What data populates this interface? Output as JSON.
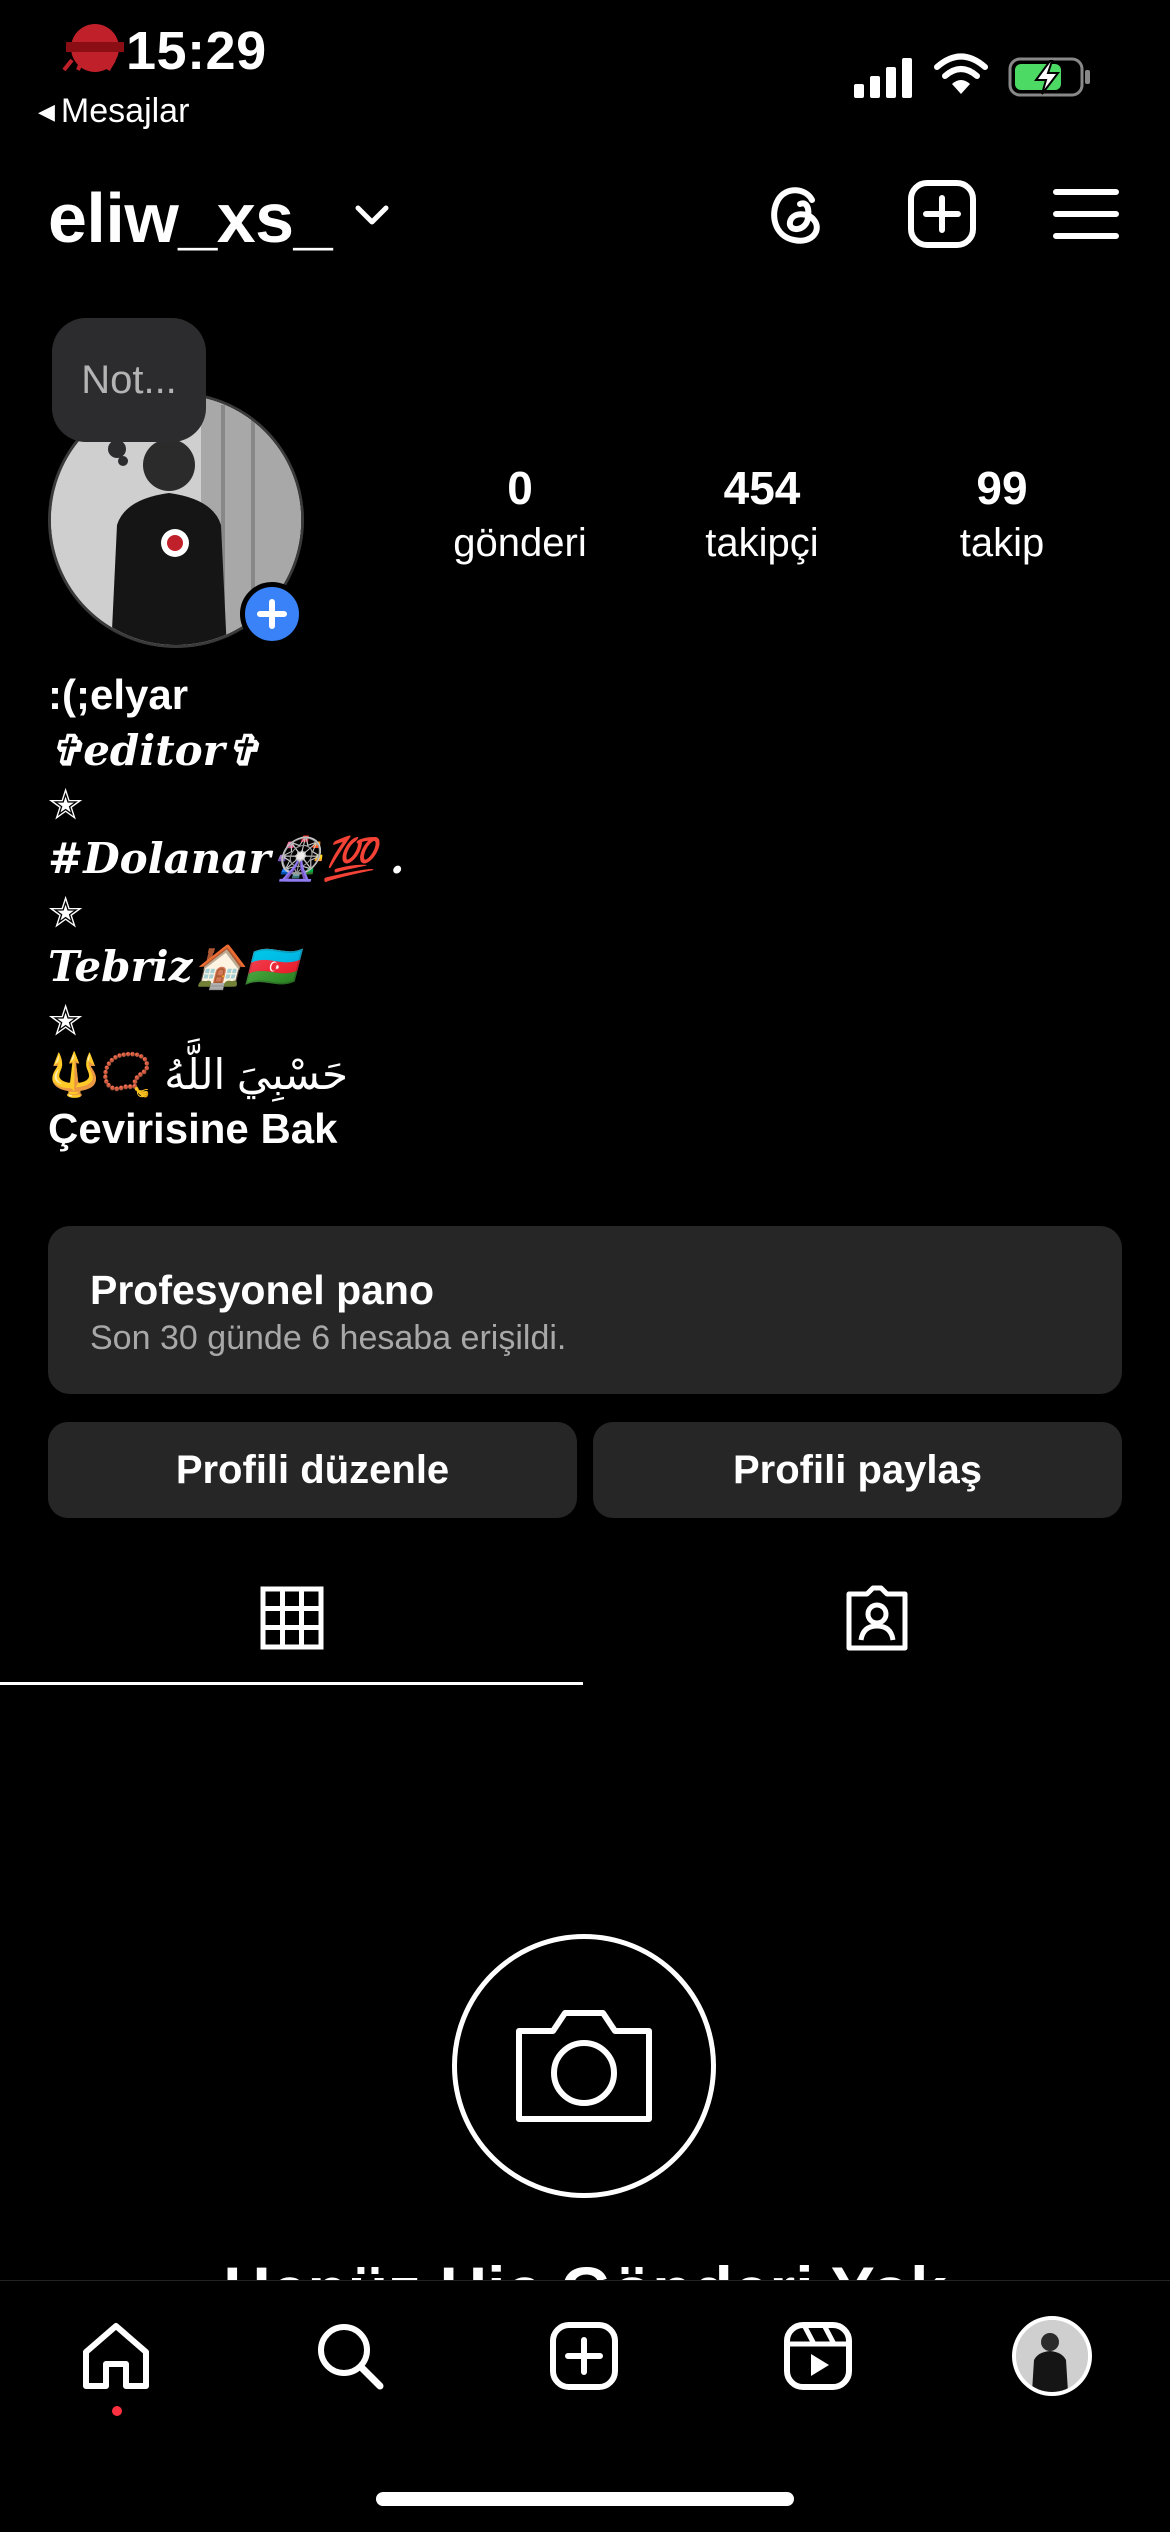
{
  "status_bar": {
    "time": "15:29",
    "back_label": "Mesajlar",
    "battery": "charging"
  },
  "header": {
    "username": "eliw_xs_",
    "icons": [
      "threads-icon",
      "create-plus-icon",
      "menu-icon"
    ]
  },
  "note": {
    "placeholder": "Not..."
  },
  "stats": [
    {
      "value": "0",
      "label": "gönderi"
    },
    {
      "value": "454",
      "label": "takipçi"
    },
    {
      "value": "99",
      "label": "takip"
    }
  ],
  "bio": {
    "name": ":(;elyar",
    "lines": [
      "✞editor✞",
      "✭",
      "#Dolanar🎡💯 .",
      "✭",
      "Tebriz🏠🇦🇿",
      "✭",
      "🔱📿 حَسْبِيَ اللَّهُ"
    ],
    "translate_link": "Çevirisine Bak"
  },
  "dashboard": {
    "title": "Profesyonel pano",
    "subtitle": "Son 30 günde 6 hesaba erişildi."
  },
  "buttons": {
    "edit_profile": "Profili düzenle",
    "share_profile": "Profili paylaş"
  },
  "tabs": {
    "active": "grid",
    "items": [
      "grid-icon",
      "tagged-icon"
    ]
  },
  "empty_state": {
    "text": "Henüz Hiç Gönderi Yok"
  },
  "bottom_nav": {
    "items": [
      "home-icon",
      "search-icon",
      "create-icon",
      "reels-icon",
      "profile-avatar"
    ],
    "active": "home"
  },
  "colors": {
    "background": "#000000",
    "card": "#262626",
    "accent_blue": "#3a82f7",
    "notification_red": "#ff3040",
    "battery_green": "#4cd964"
  }
}
